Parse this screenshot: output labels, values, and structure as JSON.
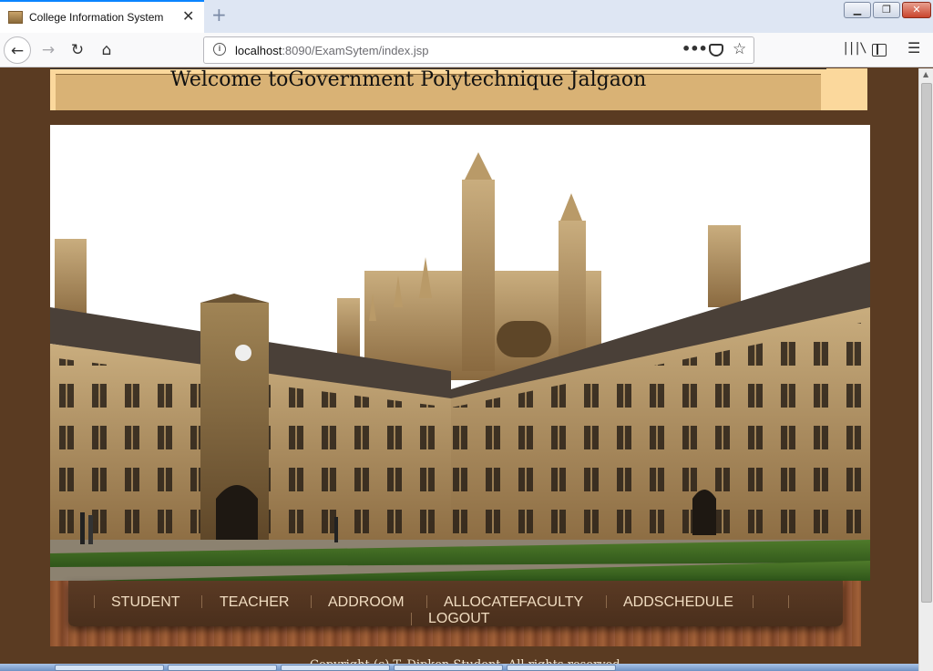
{
  "browser": {
    "tab_title": "College Information System",
    "url_host": "localhost",
    "url_rest": ":8090/ExamSytem/index.jsp",
    "icons": {
      "back": "back-arrow-icon",
      "forward": "forward-arrow-icon",
      "reload": "reload-icon",
      "home": "home-icon",
      "info": "info-icon",
      "more": "more-icon",
      "pocket": "pocket-icon",
      "bookmark": "star-icon",
      "library": "library-icon",
      "sidebar": "sidebar-icon",
      "menu": "menu-icon"
    }
  },
  "page": {
    "welcome_title": "Welcome toGovernment Polytechnique Jalgaon",
    "menu": [
      "STUDENT",
      "TEACHER",
      "ADDROOM",
      "ALLOCATEFACULTY",
      "ADDSCHEDULE",
      "LOGOUT"
    ],
    "footer": "Copyright (c) T. Dipken Student. All rights reserved."
  },
  "colors": {
    "background": "#5a3b22",
    "header_bg": "#fbd89c",
    "header_inner": "#d9b275",
    "menu_text": "#f0dcc0",
    "menu_panel": "#4a2f1c"
  }
}
